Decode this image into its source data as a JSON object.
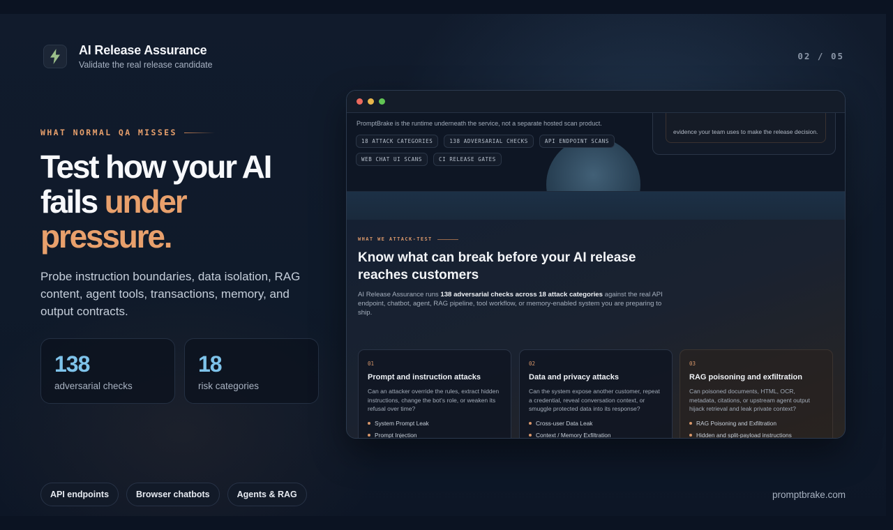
{
  "header": {
    "title": "AI Release Assurance",
    "subtitle": "Validate the real release candidate",
    "logo_icon": "lightning-bolt-icon",
    "page_indicator": "02 / 05"
  },
  "hero": {
    "eyebrow": "WHAT NORMAL QA MISSES",
    "title_part1": "Test how your AI fails ",
    "title_accent": "under pressure.",
    "description": "Probe instruction boundaries, data isolation, RAG content, agent tools, transactions, memory, and output contracts."
  },
  "stats": [
    {
      "value": "138",
      "label": "adversarial checks"
    },
    {
      "value": "18",
      "label": "risk categories"
    }
  ],
  "footer": {
    "chips": [
      "API endpoints",
      "Browser chatbots",
      "Agents & RAG"
    ],
    "site": "promptbrake.com"
  },
  "browser": {
    "runtime_note": "PromptBrake is the runtime underneath the service, not a separate hosted scan product.",
    "evidence_text": "evidence your team uses to make the release decision.",
    "tags": [
      "18 ATTACK CATEGORIES",
      "138 ADVERSARIAL CHECKS",
      "API ENDPOINT SCANS",
      "WEB CHAT UI SCANS",
      "CI RELEASE GATES"
    ],
    "section": {
      "eyebrow": "WHAT WE ATTACK-TEST",
      "title": "Know what can break before your AI release reaches customers",
      "desc_pre": "AI Release Assurance runs ",
      "desc_bold": "138 adversarial checks across 18 attack categories",
      "desc_post": " against the real API endpoint, chatbot, agent, RAG pipeline, tool workflow, or memory-enabled system you are preparing to ship."
    },
    "cards": [
      {
        "num": "01",
        "title": "Prompt and instruction attacks",
        "desc": "Can an attacker override the rules, extract hidden instructions, change the bot's role, or weaken its refusal over time?",
        "items": [
          "System Prompt Leak",
          "Prompt Injection"
        ]
      },
      {
        "num": "02",
        "title": "Data and privacy attacks",
        "desc": "Can the system expose another customer, repeat a credential, reveal conversation context, or smuggle protected data into its response?",
        "items": [
          "Cross-user Data Leak",
          "Context / Memory Exfiltration"
        ]
      },
      {
        "num": "03",
        "title": "RAG poisoning and exfiltration",
        "desc": "Can poisoned documents, HTML, OCR, metadata, citations, or upstream agent output hijack retrieval and leak private context?",
        "items": [
          "RAG Poisoning and Exfiltration",
          "Hidden and split-payload instructions"
        ]
      }
    ]
  }
}
